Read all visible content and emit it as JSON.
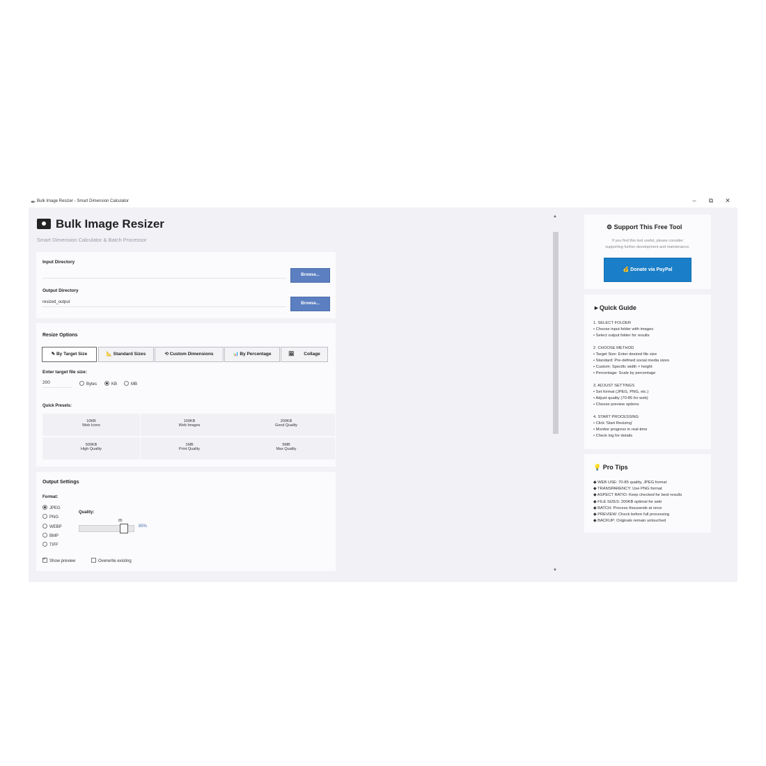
{
  "window": {
    "title": "Bulk Image Resizer - Smart Dimension Calculator",
    "controls": {
      "minimize": "–",
      "restore": "⧉",
      "close": "✕"
    }
  },
  "header": {
    "title": "Bulk Image Resizer",
    "subtitle": "Smart Dimension Calculator & Batch Processor"
  },
  "directories": {
    "input_label": "Input Directory",
    "input_value": "",
    "output_label": "Output Directory",
    "output_value": "resized_output",
    "browse_label": "Browse..."
  },
  "resize": {
    "section_title": "Resize Options",
    "tabs": [
      {
        "icon": "✎",
        "label": "By Target Size"
      },
      {
        "icon": "📐",
        "label": "Standard Sizes"
      },
      {
        "icon": "⟲",
        "label": "Custom Dimensions"
      },
      {
        "icon": "📊",
        "label": "By Percentage"
      },
      {
        "icon": "🖼",
        "label": "Collage"
      }
    ],
    "target_label": "Enter target file size:",
    "target_value": "200",
    "units": [
      "Bytes",
      "KB",
      "MB"
    ],
    "selected_unit": "KB",
    "presets_label": "Quick Presets:",
    "presets": [
      {
        "value": "10KB",
        "desc": "Web Icons"
      },
      {
        "value": "100KB",
        "desc": "Web Images"
      },
      {
        "value": "200KB",
        "desc": "Good Quality"
      },
      {
        "value": "500KB",
        "desc": "High Quality"
      },
      {
        "value": "1MB",
        "desc": "Print Quality"
      },
      {
        "value": "5MB",
        "desc": "Max Quality"
      }
    ]
  },
  "output": {
    "section_title": "Output Settings",
    "format_label": "Format:",
    "formats": [
      "JPEG",
      "PNG",
      "WEBP",
      "BMP",
      "TIFF"
    ],
    "selected_format": "JPEG",
    "quality_label": "Quality:",
    "quality_value": 85,
    "quality_tick": "85",
    "quality_display": "85%",
    "show_preview_label": "Show preview",
    "show_preview": true,
    "overwrite_label": "Overwrite existing",
    "overwrite": false
  },
  "support": {
    "title": "Support This Free Tool",
    "text1": "If you find this tool useful, please consider",
    "text2": "supporting further development and maintenance.",
    "donate_label": "Donate via PayPal"
  },
  "guide": {
    "title": "Quick Guide",
    "lines": [
      "1. SELECT FOLDER",
      "• Choose input folder with images",
      "• Select output folder for results",
      "",
      "2. CHOOSE METHOD",
      "• Target Size: Enter desired file size",
      "• Standard: Pre-defined social media sizes",
      "• Custom: Specific width × height",
      "• Percentage: Scale by percentage",
      "",
      "3. ADJUST SETTINGS",
      "• Set format (JPEG, PNG, etc.)",
      "• Adjust quality (70-85 for web)",
      "• Choose preview options",
      "",
      "4. START PROCESSING",
      "• Click 'Start Resizing'",
      "• Monitor progress in real-time",
      "• Check log for details"
    ]
  },
  "tips": {
    "title": "Pro Tips",
    "lines": [
      "WEB USE: 70-85 quality, JPEG format",
      "TRANSPARENCY: Use PNG format",
      "ASPECT RATIO: Keep checked for best results",
      "FILE SIZES: 200KB optimal for web",
      "BATCH: Process thousands at once",
      "PREVIEW: Check before full processing",
      "BACKUP: Originals remain untouched"
    ]
  }
}
